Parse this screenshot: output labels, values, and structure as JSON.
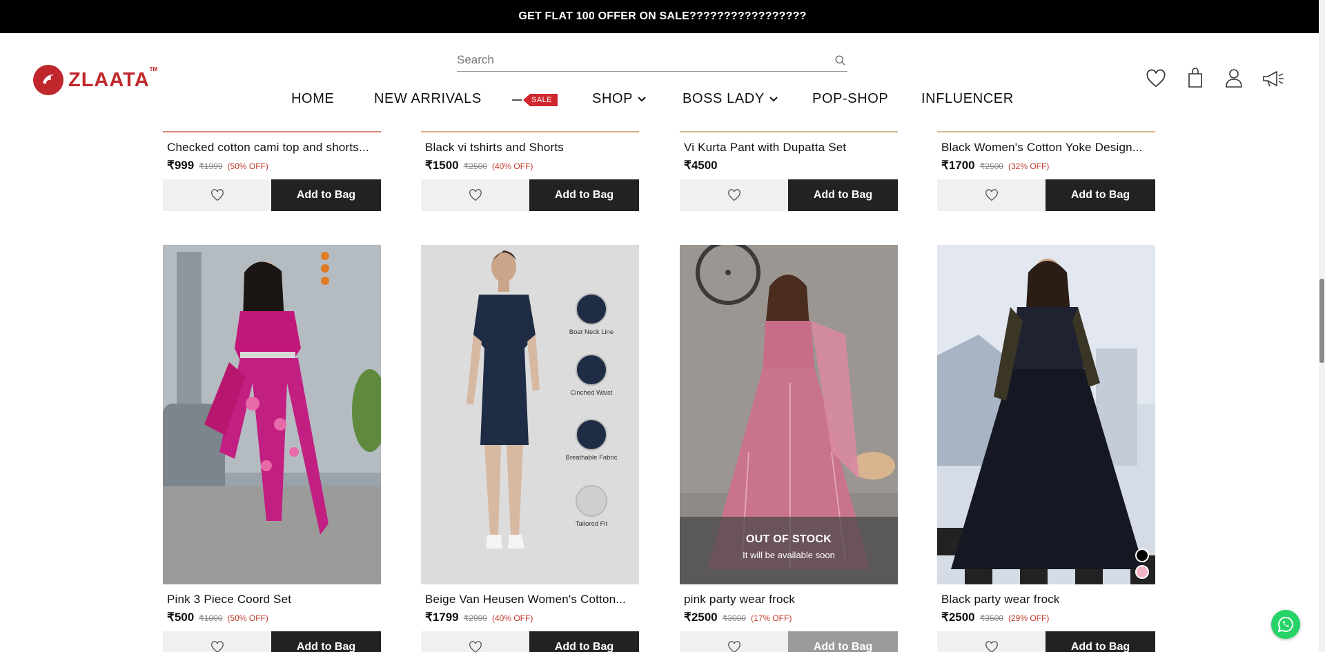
{
  "announcement": "GET FLAT 100 OFFER ON SALE?????????????????",
  "brand": {
    "name": "ZLAATA",
    "tm": "TM",
    "color": "#c0272d"
  },
  "search": {
    "placeholder": "Search"
  },
  "nav": {
    "home": "HOME",
    "new_arrivals": "NEW ARRIVALS",
    "sale_tag": "SALE",
    "shop": "SHOP",
    "boss_lady": "BOSS LADY",
    "pop_shop": "POP-SHOP",
    "influencer": "INFLUENCER"
  },
  "header_icons": [
    "heart-icon",
    "shopping-bag-icon",
    "user-icon",
    "megaphone-icon"
  ],
  "add_to_bag_label": "Add to Bag",
  "products_row1": [
    {
      "name": "Checked cotton cami top and shorts...",
      "price": "₹999",
      "old_price": "₹1999",
      "discount": "(50% OFF)"
    },
    {
      "name": "Black vi tshirts and Shorts",
      "price": "₹1500",
      "old_price": "₹2500",
      "discount": "(40% OFF)"
    },
    {
      "name": "Vi Kurta Pant with Dupatta Set",
      "price": "₹4500",
      "old_price": "",
      "discount": ""
    },
    {
      "name": "Black Women's Cotton Yoke Design...",
      "price": "₹1700",
      "old_price": "₹2500",
      "discount": "(32% OFF)"
    }
  ],
  "products_row2": [
    {
      "name": "Pink 3 Piece Coord Set",
      "price": "₹500",
      "old_price": "₹1000",
      "discount": "(50% OFF)"
    },
    {
      "name": "Beige Van Heusen Women's Cotton...",
      "price": "₹1799",
      "old_price": "₹2999",
      "discount": "(40% OFF)"
    },
    {
      "name": "pink party wear frock",
      "price": "₹2500",
      "old_price": "₹3000",
      "discount": "(17% OFF)"
    },
    {
      "name": "Black party wear frock",
      "price": "₹2500",
      "old_price": "₹3500",
      "discount": "(29% OFF)"
    }
  ],
  "dress_features": [
    "Boat Neck Line",
    "Cinched Waist",
    "Breathable Fabric",
    "Tailored Fit"
  ],
  "out_of_stock": {
    "title": "OUT OF STOCK",
    "subtitle": "It will be available soon"
  },
  "colors": {
    "accent": "#c0272d",
    "button": "#222222",
    "button_disabled": "#9a9a9a",
    "discount": "#c0392b"
  }
}
